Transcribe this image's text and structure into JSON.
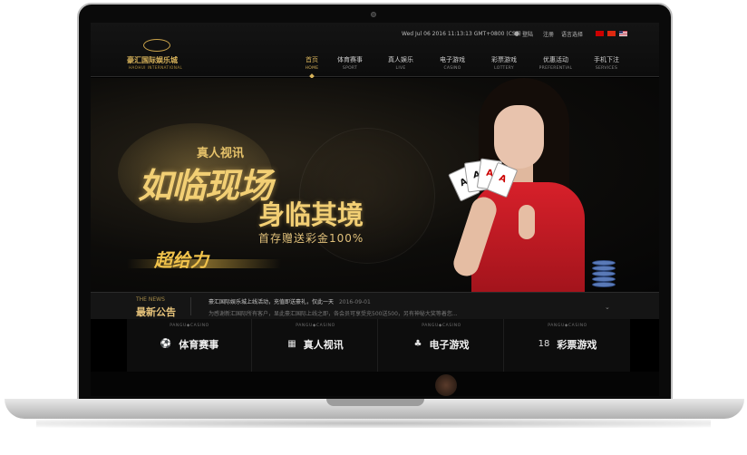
{
  "header": {
    "logo_cn": "豪汇国际娱乐城",
    "logo_en": "HAOHUI INTERNATIONAL",
    "datetime": "Wed Jul 06 2016 11:13:13 GMT+0800 (CST)",
    "login": "登陆",
    "register": "注册",
    "language": "语言选择"
  },
  "nav": [
    {
      "cn": "首页",
      "en": "HOME",
      "active": true
    },
    {
      "cn": "体育赛事",
      "en": "SPORT"
    },
    {
      "cn": "真人娱乐",
      "en": "LIVE"
    },
    {
      "cn": "电子游戏",
      "en": "CASINO"
    },
    {
      "cn": "彩票游戏",
      "en": "LOTTERY"
    },
    {
      "cn": "优惠活动",
      "en": "PREFERENTIAL"
    },
    {
      "cn": "手机下注",
      "en": "SERVICES"
    }
  ],
  "hero": {
    "tag": "真人视讯",
    "line1": "如临现场",
    "line2": "身临其境",
    "sub": "首存赠送彩金100%",
    "power": "超给力",
    "cards": [
      "A",
      "A",
      "A",
      "A"
    ]
  },
  "news": {
    "title_en": "THE NEWS",
    "title_cn": "最新公告",
    "item1": "豪汇国际娱乐城上线活动，充值即送豪礼，仅此一天",
    "item1_date": "2016-09-01",
    "item2": "为感谢新汇国际所有客户，显此豪汇国际上线之即，各会员可享受充500送500，另有神秘大奖等着您..."
  },
  "games": [
    {
      "brand": "PANGU◆CASINO",
      "icon": "⚽",
      "label": "体育赛事"
    },
    {
      "brand": "PANGU◆CASINO",
      "icon": "▦",
      "label": "真人视讯"
    },
    {
      "brand": "PANGU◆CASINO",
      "icon": "♣",
      "label": "电子游戏"
    },
    {
      "brand": "PANGU◆CASINO",
      "icon": "18",
      "label": "彩票游戏"
    }
  ],
  "colors": {
    "gold": "#d8b35b",
    "dress": "#d7202a",
    "bg": "#000000"
  }
}
